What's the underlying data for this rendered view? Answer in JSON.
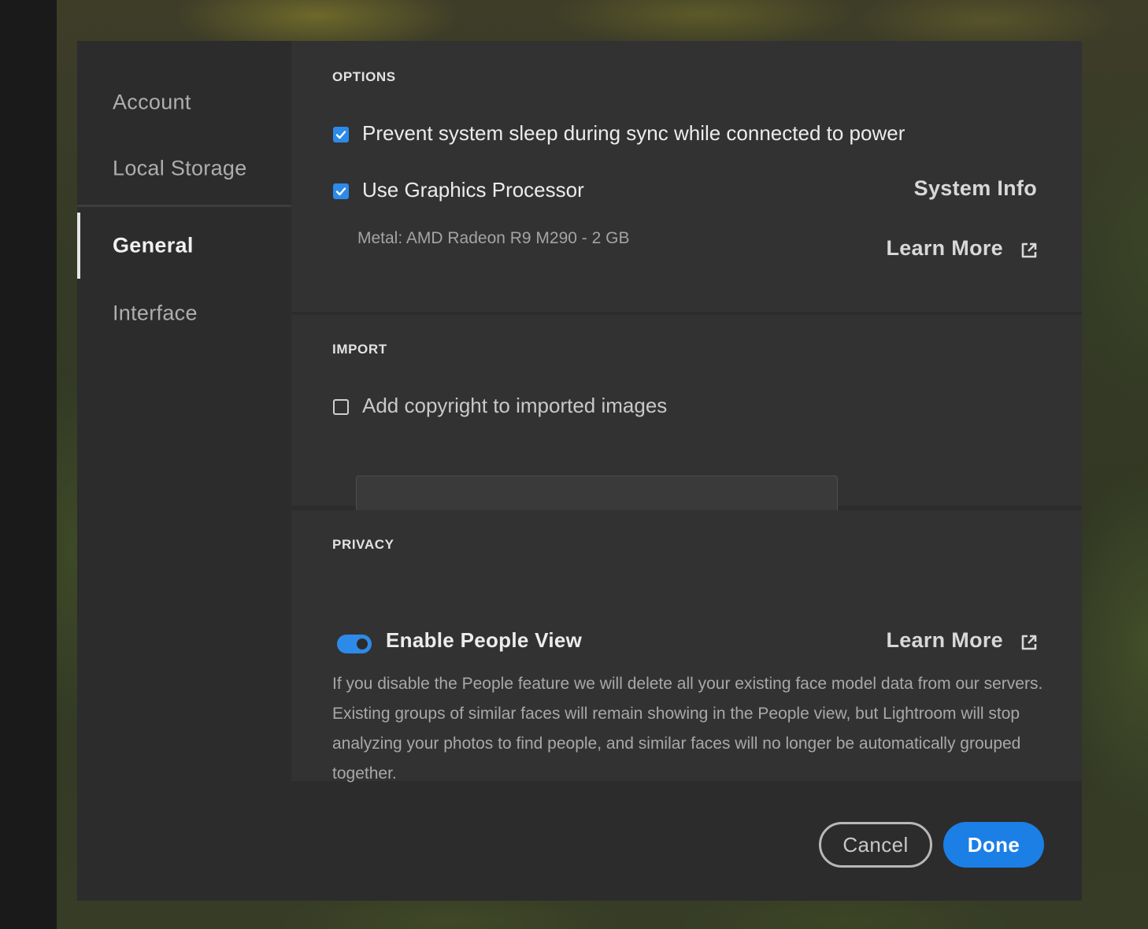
{
  "sidebar": {
    "items": [
      {
        "label": "Account"
      },
      {
        "label": "Local Storage"
      },
      {
        "label": "General",
        "active": true
      },
      {
        "label": "Interface"
      }
    ]
  },
  "options": {
    "heading": "OPTIONS",
    "prevent_sleep": {
      "label": "Prevent system sleep during sync while connected to power",
      "checked": true
    },
    "use_gpu": {
      "label": "Use Graphics Processor",
      "checked": true
    },
    "gpu_info": "Metal: AMD Radeon R9 M290 - 2 GB",
    "system_info_link": "System Info",
    "learn_more_link": "Learn More"
  },
  "import": {
    "heading": "IMPORT",
    "copyright": {
      "label": "Add copyright to imported images",
      "checked": false
    },
    "copyright_value": ""
  },
  "privacy": {
    "heading": "PRIVACY",
    "people_view": {
      "label": "Enable People View",
      "enabled": true
    },
    "learn_more_link": "Learn More",
    "description": "If you disable the People feature we will delete all your existing face model data from our servers. Existing groups of similar faces will remain showing in the People view, but Lightroom will stop analyzing your photos to find people, and similar faces will no longer be automatically grouped together."
  },
  "footer": {
    "cancel_label": "Cancel",
    "done_label": "Done"
  },
  "colors": {
    "accent": "#2d8ae8",
    "done_button": "#1b7fe6",
    "dialog_bg": "#2c2c2c",
    "section_bg": "#323232"
  }
}
